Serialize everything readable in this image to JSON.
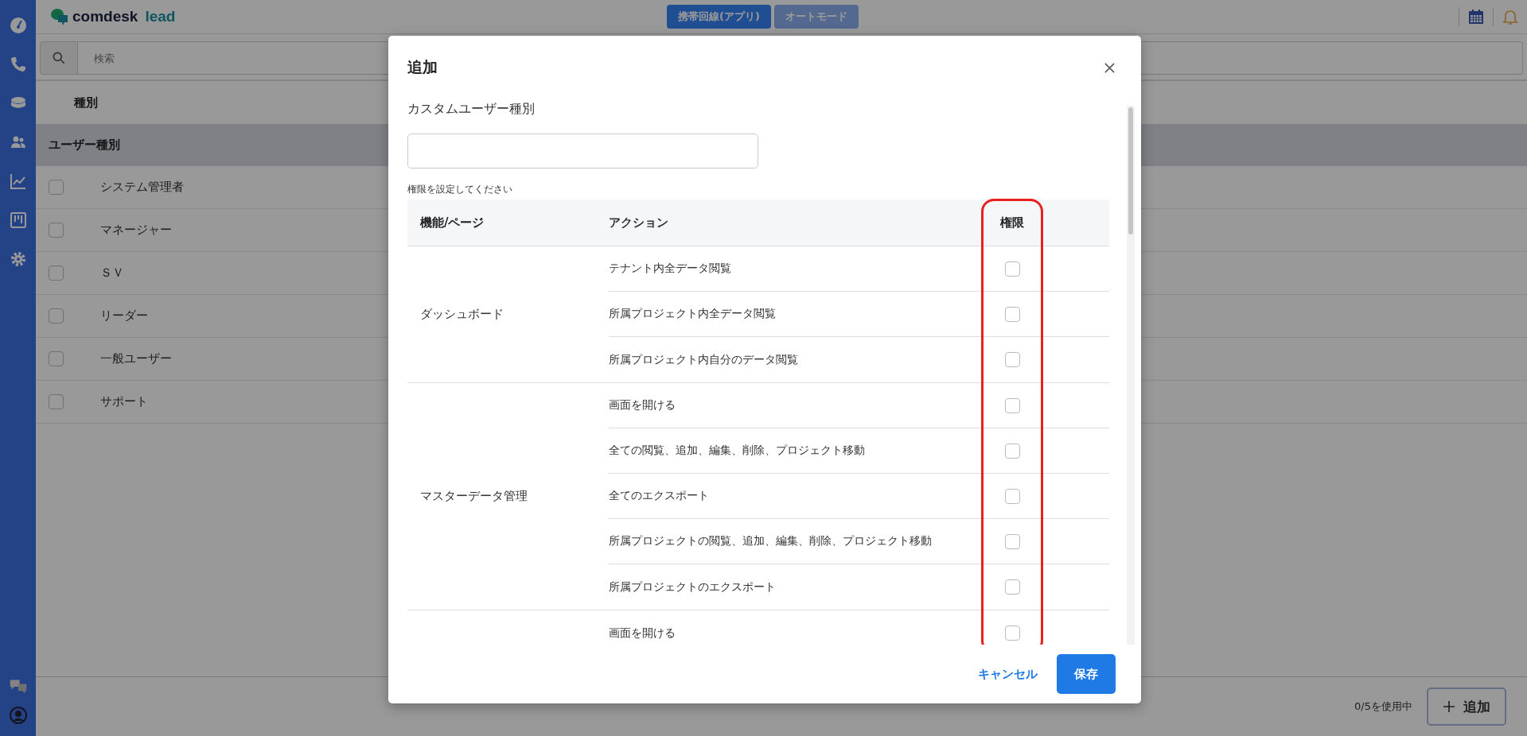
{
  "header": {
    "logo": {
      "word1": "comdesk",
      "word2": "lead"
    },
    "mode_buttons": [
      {
        "label": "携帯回線(アプリ)",
        "selected": true
      },
      {
        "label": "オートモード",
        "selected": false
      }
    ]
  },
  "search": {
    "placeholder": "検索"
  },
  "list": {
    "column": "種別",
    "group": "ユーザー種別",
    "rows": [
      {
        "label": "システム管理者",
        "checked": false
      },
      {
        "label": "マネージャー",
        "checked": false
      },
      {
        "label": "ＳＶ",
        "checked": false
      },
      {
        "label": "リーダー",
        "checked": false
      },
      {
        "label": "一般ユーザー",
        "checked": false
      },
      {
        "label": "サポート",
        "checked": false
      }
    ]
  },
  "footer": {
    "usage": "0/5を使用中",
    "add_button": "追加"
  },
  "dialog": {
    "title": "追加",
    "name_label": "カスタムユーザー種別",
    "hint": "権限を設定してください",
    "columns": [
      "機能/ページ",
      "アクション",
      "権限"
    ],
    "groups": [
      {
        "feature": "ダッシュボード",
        "actions": [
          {
            "label": "テナント内全データ閲覧",
            "checked": false
          },
          {
            "label": "所属プロジェクト内全データ閲覧",
            "checked": false
          },
          {
            "label": "所属プロジェクト内自分のデータ閲覧",
            "checked": false
          }
        ]
      },
      {
        "feature": "マスターデータ管理",
        "actions": [
          {
            "label": "画面を開ける",
            "checked": false
          },
          {
            "label": "全ての閲覧、追加、編集、削除、プロジェクト移動",
            "checked": false
          },
          {
            "label": "全てのエクスポート",
            "checked": false
          },
          {
            "label": "所属プロジェクトの閲覧、追加、編集、削除、プロジェクト移動",
            "checked": false
          },
          {
            "label": "所属プロジェクトのエクスポート",
            "checked": false
          }
        ]
      },
      {
        "actions": [
          {
            "label": "画面を開ける",
            "checked": false
          }
        ]
      }
    ],
    "cancel": "キャンセル",
    "save": "保存"
  }
}
